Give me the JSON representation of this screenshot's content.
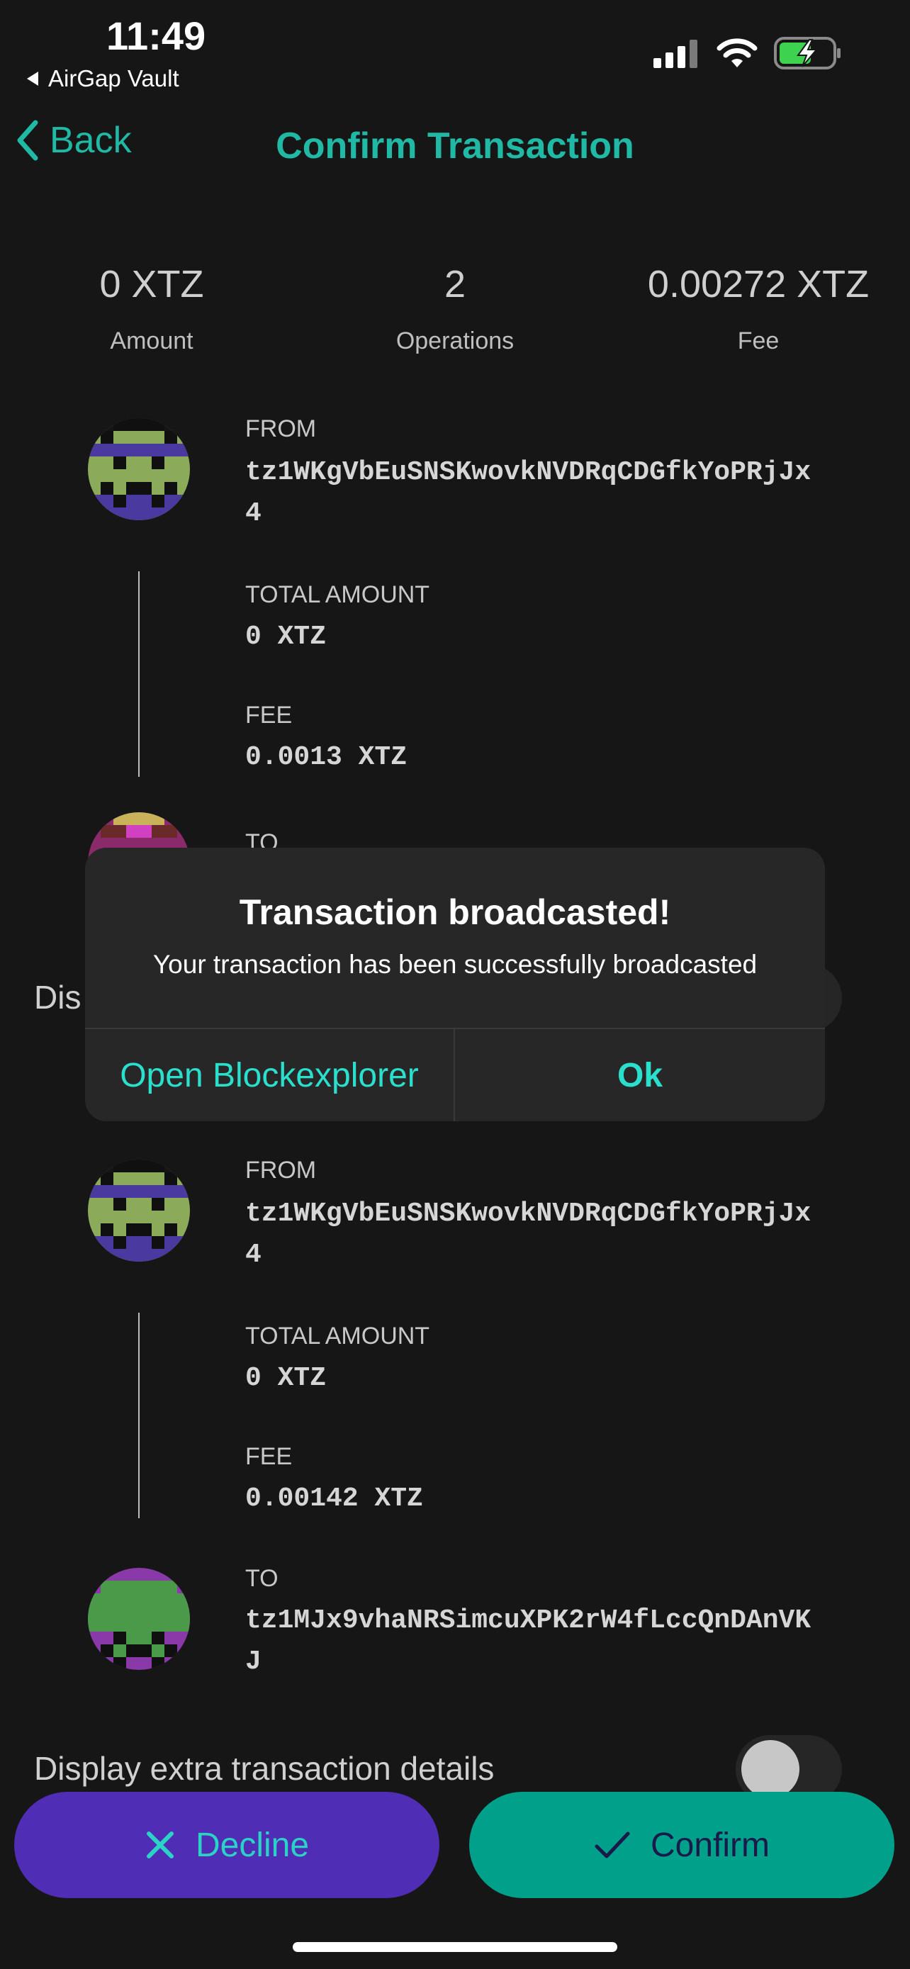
{
  "status_bar": {
    "time": "11:49",
    "back_app": "AirGap Vault"
  },
  "header": {
    "back_label": "Back",
    "title": "Confirm Transaction"
  },
  "summary": {
    "amount_value": "0 XTZ",
    "amount_label": "Amount",
    "operations_value": "2",
    "operations_label": "Operations",
    "fee_value": "0.00272 XTZ",
    "fee_label": "Fee"
  },
  "operation1": {
    "from_label": "FROM",
    "from_address_line1": "tz1WKgVbEuSNSKwovkNVDRqCDGfkYoPRjJx",
    "from_address_line2": "4",
    "total_amount_label": "TOTAL AMOUNT",
    "total_amount_value": "0 XTZ",
    "fee_label": "FEE",
    "fee_value": "0.0013 XTZ",
    "to_label": "TO"
  },
  "partial_toggle_label": "Dis",
  "operation2": {
    "from_label": "FROM",
    "from_address_line1": "tz1WKgVbEuSNSKwovkNVDRqCDGfkYoPRjJx",
    "from_address_line2": "4",
    "total_amount_label": "TOTAL AMOUNT",
    "total_amount_value": "0 XTZ",
    "fee_label": "FEE",
    "fee_value": "0.00142 XTZ",
    "to_label": "TO",
    "to_address_line1": "tz1MJx9vhaNRSimcuXPK2rW4fLccQnDAnVK",
    "to_address_line2": "J"
  },
  "extra_details_label": "Display extra transaction details",
  "extra_details_enabled": false,
  "buttons": {
    "decline": "Decline",
    "confirm": "Confirm"
  },
  "alert": {
    "title": "Transaction broadcasted!",
    "message": "Your transaction has been successfully broadcasted",
    "open_explorer": "Open Blockexplorer",
    "ok": "Ok"
  },
  "colors": {
    "accent": "#1fb9a5",
    "decline_bg": "#4f2db4",
    "confirm_bg": "#00a08a",
    "alert_link": "#2ae0cd"
  }
}
